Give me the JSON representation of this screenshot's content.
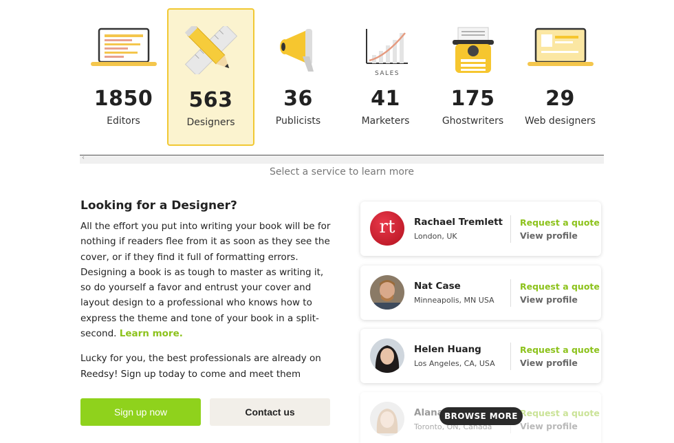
{
  "services": [
    {
      "count": "1850",
      "label": "Editors",
      "icon": "laptop-document-icon",
      "selected": false
    },
    {
      "count": "563",
      "label": "Designers",
      "icon": "pencil-ruler-icon",
      "selected": true
    },
    {
      "count": "36",
      "label": "Publicists",
      "icon": "megaphone-icon",
      "selected": false
    },
    {
      "count": "41",
      "label": "Marketers",
      "icon": "sales-chart-icon",
      "selected": false
    },
    {
      "count": "175",
      "label": "Ghostwriters",
      "icon": "typewriter-icon",
      "selected": false
    },
    {
      "count": "29",
      "label": "Web designers",
      "icon": "laptop-website-icon",
      "selected": false
    }
  ],
  "sales_label": "SALES",
  "hint": "Select a service to learn more",
  "intro": {
    "title": "Looking for a Designer?",
    "paragraph1": "All the effort you put into writing your book will be for nothing if readers flee from it as soon as they see the cover, or if they find it full of formatting errors. Designing a book is as tough to master as writing it, so do yourself a favor and entrust your cover and layout design to a professional who knows how to express the theme and tone of your book in a split-second.",
    "learn_more": "Learn more.",
    "paragraph2": "Lucky for you, the best professionals are already on Reedsy! Sign up today to come and meet them"
  },
  "buttons": {
    "signup": "Sign up now",
    "contact": "Contact us"
  },
  "professionals": [
    {
      "name": "Rachael Tremlett",
      "location": "London, UK",
      "initials": "rt",
      "quote": "Request a quote",
      "profile": "View profile"
    },
    {
      "name": "Nat Case",
      "location": "Minneapolis, MN USA",
      "quote": "Request a quote",
      "profile": "View profile"
    },
    {
      "name": "Helen Huang",
      "location": "Los Angeles, CA, USA",
      "quote": "Request a quote",
      "profile": "View profile"
    },
    {
      "name": "Alana",
      "location": "Toronto, ON, Canada",
      "quote": "Request a quote",
      "profile": "View profile"
    }
  ],
  "browse_more": "BROWSE MORE",
  "colors": {
    "accent_green": "#8cc21b",
    "button_green": "#8fd21c",
    "selected_yellow": "#f1c832",
    "selected_bg": "#fbf3cf"
  }
}
